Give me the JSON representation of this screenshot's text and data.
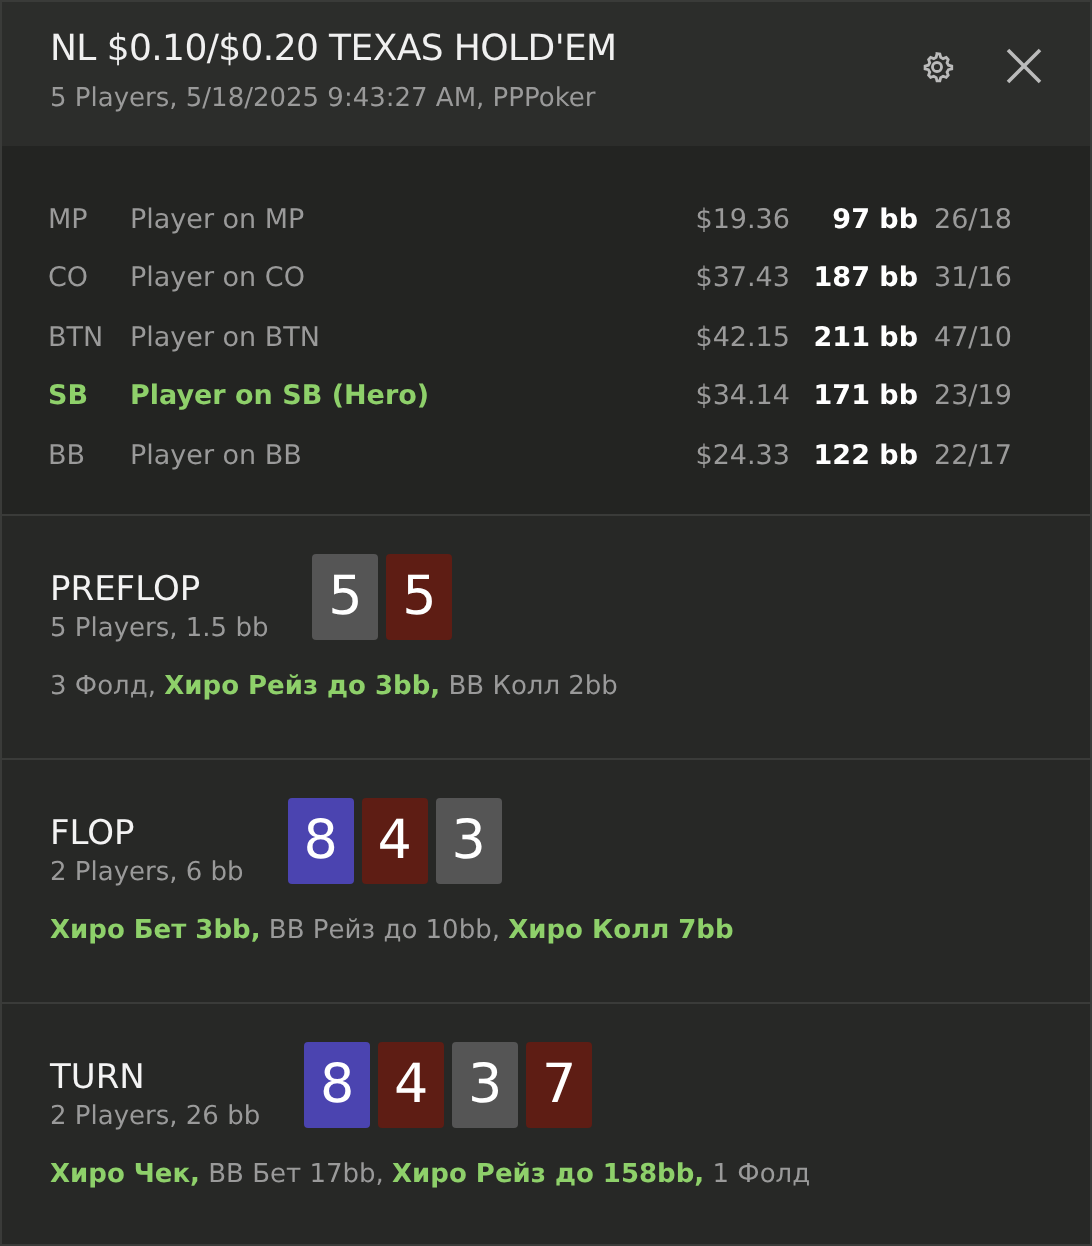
{
  "window": {
    "title": "NL $0.10/$0.20 TEXAS HOLD'EM",
    "subtitle": "5 Players, 5/18/2025 9:43:27 AM, PPPoker"
  },
  "players": [
    {
      "position": "MP",
      "name": "Player on MP",
      "stack": "$19.36",
      "stack_bb": "97 bb",
      "stats": "26/18",
      "hero": false
    },
    {
      "position": "CO",
      "name": "Player on CO",
      "stack": "$37.43",
      "stack_bb": "187 bb",
      "stats": "31/16",
      "hero": false
    },
    {
      "position": "BTN",
      "name": "Player on BTN",
      "stack": "$42.15",
      "stack_bb": "211 bb",
      "stats": "47/10",
      "hero": false
    },
    {
      "position": "SB",
      "name": "Player on SB (Hero)",
      "stack": "$34.14",
      "stack_bb": "171 bb",
      "stats": "23/19",
      "hero": true
    },
    {
      "position": "BB",
      "name": "Player on BB",
      "stack": "$24.33",
      "stack_bb": "122 bb",
      "stats": "22/17",
      "hero": false
    }
  ],
  "streets": [
    {
      "name": "PREFLOP",
      "info": "5 Players, 1.5 bb",
      "cards": [
        {
          "rank": "5",
          "color": "#555555"
        },
        {
          "rank": "5",
          "color": "#5e1d14"
        }
      ],
      "actions": "3 Фолд, **Хиро Рейз до 3bb,** BB Колл 2bb"
    },
    {
      "name": "FLOP",
      "info": "2 Players, 6 bb",
      "cards": [
        {
          "rank": "8",
          "color": "#4b44b0"
        },
        {
          "rank": "4",
          "color": "#5e1d14"
        },
        {
          "rank": "3",
          "color": "#555555"
        }
      ],
      "actions": "**Хиро Бет 3bb,** BB Рейз до 10bb, **Хиро Колл 7bb**"
    },
    {
      "name": "TURN",
      "info": "2 Players, 26 bb",
      "cards": [
        {
          "rank": "8",
          "color": "#4b44b0"
        },
        {
          "rank": "4",
          "color": "#5e1d14"
        },
        {
          "rank": "3",
          "color": "#555555"
        },
        {
          "rank": "7",
          "color": "#5e1d14"
        }
      ],
      "actions": "**Хиро Чек,** BB Бет 17bb, **Хиро Рейз до 158bb,** 1 Фолд"
    }
  ]
}
